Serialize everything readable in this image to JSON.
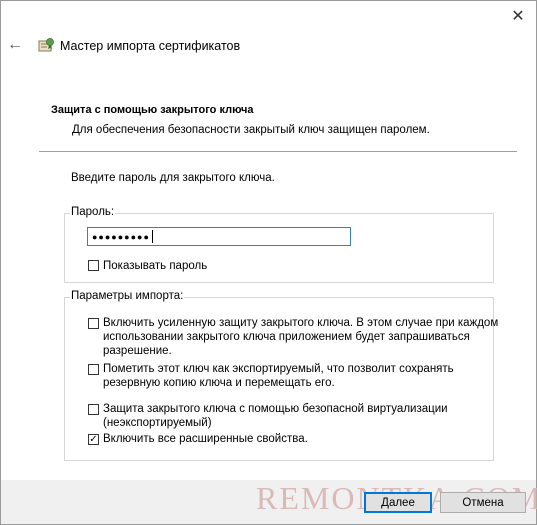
{
  "window": {
    "title": "Мастер импорта сертификатов",
    "close_glyph": "✕",
    "back_glyph": "←"
  },
  "section": {
    "heading": "Защита с помощью закрытого ключа",
    "description": "Для обеспечения безопасности закрытый ключ защищен паролем."
  },
  "prompt": "Введите пароль для закрытого ключа.",
  "password_group": {
    "legend": "Пароль:",
    "masked_value": "●●●●●●●●●",
    "show_password_label": "Показывать пароль",
    "show_password_checked": false
  },
  "import_group": {
    "legend": "Параметры импорта:",
    "options": [
      {
        "line1": "Включить усиленную защиту закрытого ключа. В этом случае при каждом",
        "line2": "использовании закрытого ключа приложением будет запрашиваться",
        "line3": "разрешение.",
        "checked": false
      },
      {
        "line1": "Пометить этот ключ как экспортируемый, что позволит сохранять",
        "line2": "резервную копию ключа и перемещать его.",
        "checked": false
      },
      {
        "line1": "Защита закрытого ключа с помощью безопасной виртуализации",
        "line2": "(неэкспортируемый)",
        "checked": false
      },
      {
        "line1": "Включить все расширенные свойства.",
        "checked": true
      }
    ]
  },
  "buttons": {
    "next": "Далее",
    "cancel": "Отмена"
  },
  "watermark": "REMONTKA.COM",
  "colors": {
    "accent": "#0078d7",
    "footer_bg": "#f0f0f0"
  },
  "icons": {
    "back": "back-arrow-icon",
    "close": "close-icon",
    "wizard": "certificate-wizard-icon"
  }
}
